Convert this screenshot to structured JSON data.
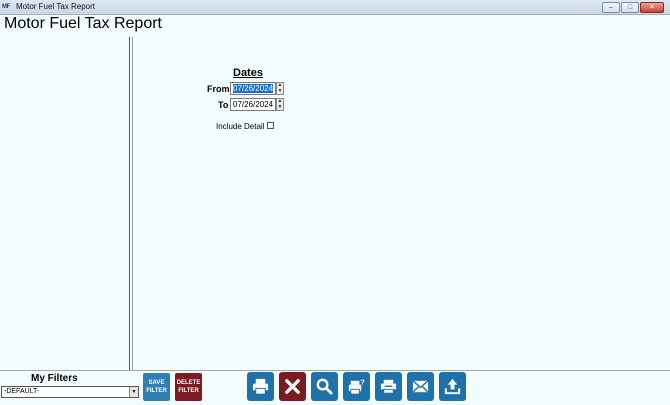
{
  "window": {
    "icon_text": "MF",
    "title": "Motor Fuel Tax Report",
    "minimize": "–",
    "maximize": "□",
    "close": "✕"
  },
  "header": {
    "title": "Motor Fuel Tax Report"
  },
  "dates": {
    "heading": "Dates",
    "from_label": "From",
    "from_value": "07/26/2024",
    "to_label": "To",
    "to_value": "07/26/2024"
  },
  "options": {
    "include_detail_label": "Include Detail",
    "include_detail_checked": false
  },
  "filters": {
    "label": "My Filters",
    "selected": "-DEFAULT-",
    "save_line1": "SAVE",
    "save_line2": "FILTER",
    "delete_line1": "DELETE",
    "delete_line2": "FILTER"
  },
  "actions": [
    {
      "name": "print-icon"
    },
    {
      "name": "cancel-icon"
    },
    {
      "name": "search-icon"
    },
    {
      "name": "print-preview-icon"
    },
    {
      "name": "printer-icon"
    },
    {
      "name": "email-icon"
    },
    {
      "name": "export-icon"
    }
  ],
  "colors": {
    "accent": "#1f72a9",
    "danger": "#7a1b22",
    "background": "#f4fdfd"
  }
}
